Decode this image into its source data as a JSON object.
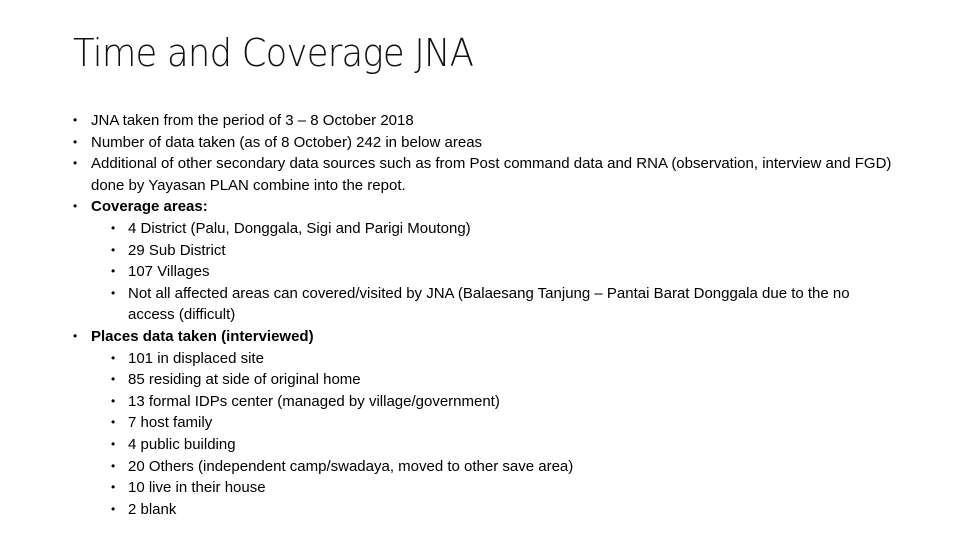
{
  "slide": {
    "title": "Time and Coverage JNA",
    "bullet_glyph": "•",
    "items": [
      {
        "level": 1,
        "bold": false,
        "text": "JNA taken from the period of 3 – 8 October 2018"
      },
      {
        "level": 1,
        "bold": false,
        "text": "Number of data taken (as of 8 October) 242 in below areas"
      },
      {
        "level": 1,
        "bold": false,
        "text": "Additional of other secondary data sources such as from Post command data and RNA (observation, interview and FGD) done by Yayasan PLAN combine into the repot."
      },
      {
        "level": 1,
        "bold": true,
        "text": "Coverage areas:"
      },
      {
        "level": 2,
        "bold": false,
        "text": "4 District (Palu, Donggala, Sigi and Parigi Moutong)"
      },
      {
        "level": 2,
        "bold": false,
        "text": "29 Sub District"
      },
      {
        "level": 2,
        "bold": false,
        "text": "107 Villages"
      },
      {
        "level": 2,
        "bold": false,
        "text": "Not all affected areas can covered/visited by JNA (Balaesang Tanjung – Pantai Barat Donggala due to the no access (difficult)"
      },
      {
        "level": 1,
        "bold": true,
        "text": "Places data taken (interviewed)"
      },
      {
        "level": 2,
        "bold": false,
        "text": "101 in displaced site"
      },
      {
        "level": 2,
        "bold": false,
        "text": "85 residing at side of original home"
      },
      {
        "level": 2,
        "bold": false,
        "text": "13 formal IDPs center (managed by village/government)"
      },
      {
        "level": 2,
        "bold": false,
        "text": "7 host family"
      },
      {
        "level": 2,
        "bold": false,
        "text": "4 public building"
      },
      {
        "level": 2,
        "bold": false,
        "text": "20 Others (independent camp/swadaya, moved to other save area)"
      },
      {
        "level": 2,
        "bold": false,
        "text": "10 live in their house"
      },
      {
        "level": 2,
        "bold": false,
        "text": "2 blank"
      }
    ]
  }
}
